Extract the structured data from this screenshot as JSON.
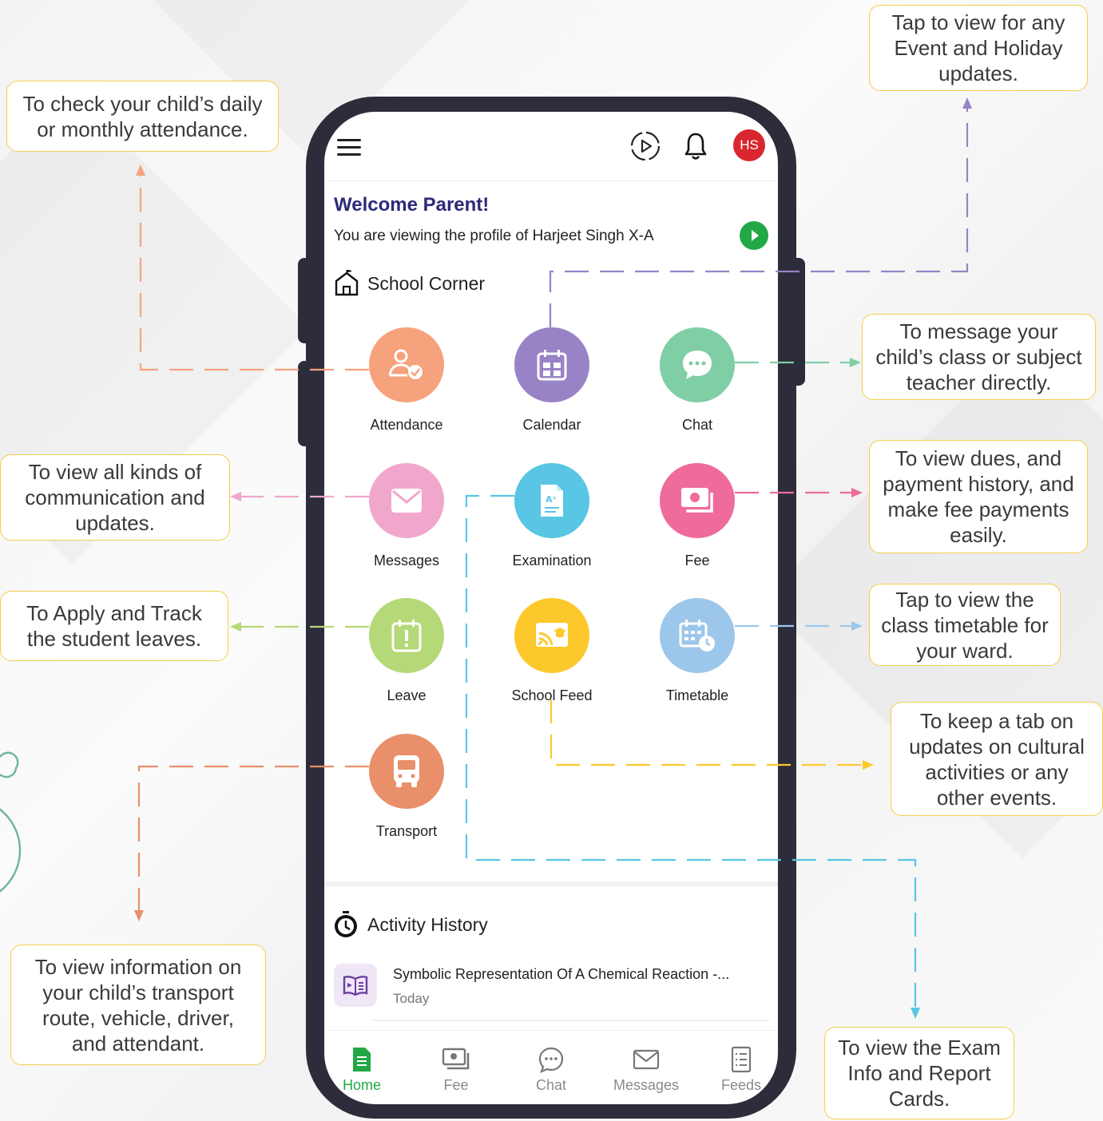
{
  "header": {
    "avatar_initials": "HS"
  },
  "welcome": {
    "title": "Welcome Parent!",
    "profile_text": "You are viewing the profile of Harjeet Singh X-A"
  },
  "school_corner": {
    "title": "School Corner",
    "tiles": [
      {
        "label": "Attendance",
        "color": "#f6a27c",
        "icon": "attendance-icon"
      },
      {
        "label": "Calendar",
        "color": "#9783c6",
        "icon": "calendar-icon"
      },
      {
        "label": "Chat",
        "color": "#7fcea6",
        "icon": "chat-icon"
      },
      {
        "label": "Messages",
        "color": "#f1a6cb",
        "icon": "envelope-icon"
      },
      {
        "label": "Examination",
        "color": "#58c6e4",
        "icon": "exam-icon"
      },
      {
        "label": "Fee",
        "color": "#ef6b9c",
        "icon": "fee-icon"
      },
      {
        "label": "Leave",
        "color": "#b5d878",
        "icon": "leave-icon"
      },
      {
        "label": "School Feed",
        "color": "#fdc82b",
        "icon": "feed-icon"
      },
      {
        "label": "Timetable",
        "color": "#9cc7ea",
        "icon": "timetable-icon"
      },
      {
        "label": "Transport",
        "color": "#e98f69",
        "icon": "bus-icon"
      }
    ]
  },
  "activity_history": {
    "title": "Activity History",
    "items": [
      {
        "title": "Symbolic Representation Of A Chemical Reaction -...",
        "date": "Today"
      }
    ]
  },
  "bottom_nav": [
    {
      "label": "Home",
      "active": true
    },
    {
      "label": "Fee"
    },
    {
      "label": "Chat"
    },
    {
      "label": "Messages"
    },
    {
      "label": "Feeds"
    }
  ],
  "callouts": {
    "attendance": "To check your child’s daily or monthly attendance.",
    "calendar": "Tap to view for any Event and Holiday updates.",
    "chat": "To message your child’s class or subject teacher directly.",
    "messages": "To view all kinds of communication and updates.",
    "fee": "To view dues, and payment history, and make fee payments easily.",
    "leave": "To Apply and Track the student leaves.",
    "timetable": "Tap to view the class timetable for your ward.",
    "feed": "To keep a tab on updates on cultural activities or any other events.",
    "transport": "To view information on your child’s transport route, vehicle, driver, and attendant.",
    "exam": "To view the Exam Info and Report Cards."
  },
  "colors": {
    "accent_green": "#22a846",
    "title_navy": "#2b2a7a",
    "callout_border": "#f2cf4a"
  }
}
